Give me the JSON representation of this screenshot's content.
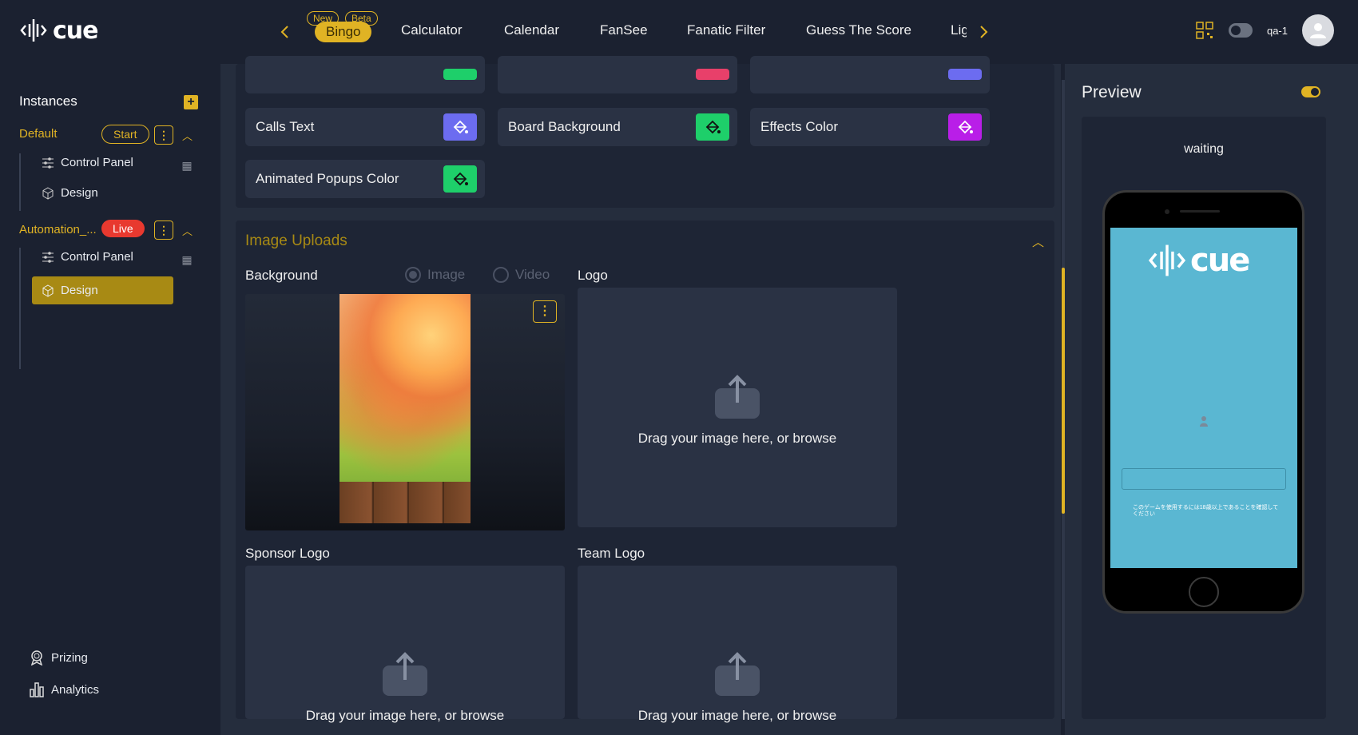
{
  "app": {
    "logo_text": "cue",
    "user_name": "qa-1"
  },
  "tabs": [
    {
      "label": "Bingo",
      "badges": [
        "New",
        "Beta"
      ]
    },
    {
      "label": "Calculator"
    },
    {
      "label": "Calendar"
    },
    {
      "label": "FanSee"
    },
    {
      "label": "Fanatic Filter"
    },
    {
      "label": "Guess The Score"
    },
    {
      "label": "Lig"
    }
  ],
  "sidebar": {
    "title": "Instances",
    "instances": [
      {
        "name": "Default",
        "status": "Start",
        "items": [
          "Control Panel",
          "Design"
        ]
      },
      {
        "name": "Automation_...",
        "status": "Live",
        "items": [
          "Control Panel",
          "Design"
        ]
      }
    ],
    "bottom": [
      "Prizing",
      "Analytics"
    ]
  },
  "colors": {
    "accent": "#e0b324",
    "rows": [
      {
        "label": "Calls Text",
        "swatch": "#6c6cf0"
      },
      {
        "label": "Board Background",
        "swatch": "#1ecf6a"
      },
      {
        "label": "Effects Color",
        "swatch": "#b91ee8"
      },
      {
        "label": "Animated Popups Color",
        "swatch": "#1ecf6a"
      }
    ],
    "partial_swatches": [
      "#1ecf6a",
      "#e8406a",
      "#6c6cf0"
    ]
  },
  "uploads": {
    "section_title": "Image Uploads",
    "background_label": "Background",
    "radio_image": "Image",
    "radio_video": "Video",
    "logo_label": "Logo",
    "sponsor_label": "Sponsor Logo",
    "team_label": "Team Logo",
    "drop_text": "Drag your image here, or browse"
  },
  "preview": {
    "title": "Preview",
    "status": "waiting",
    "screen_logo": "cue",
    "note": "このゲームを使用するには18歳以上であることを確認してください"
  }
}
